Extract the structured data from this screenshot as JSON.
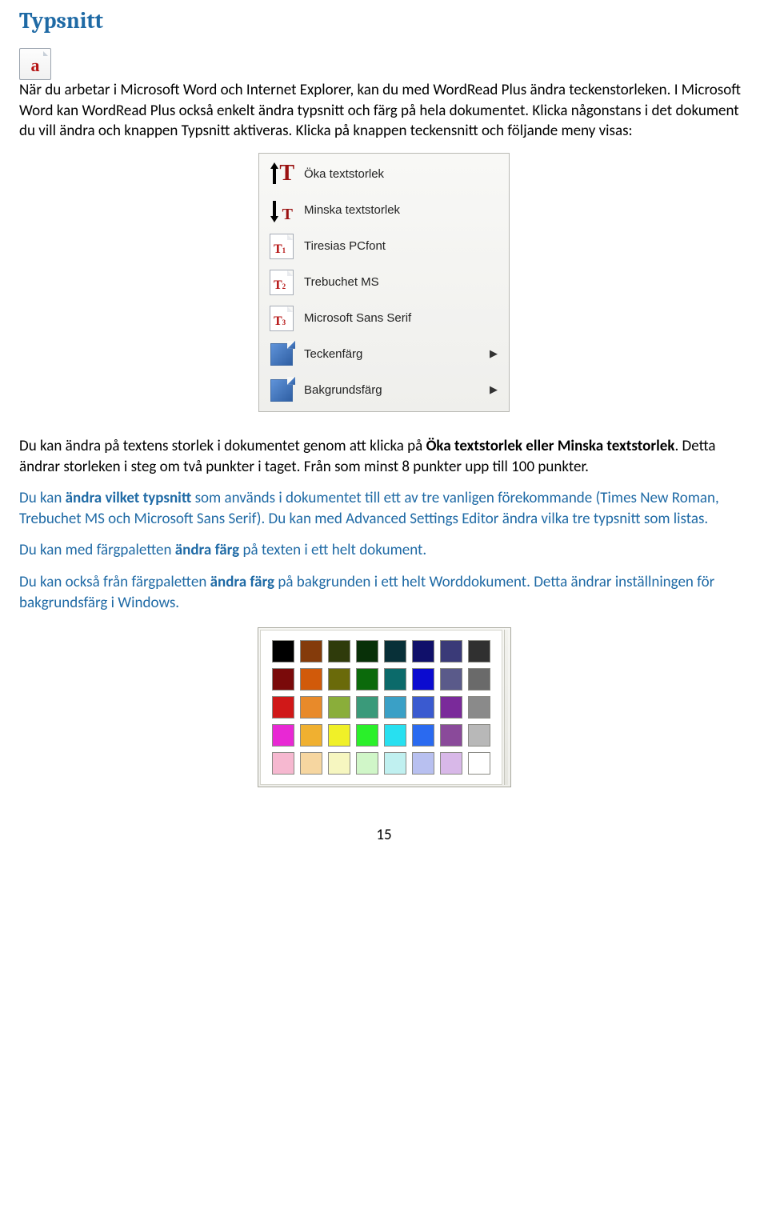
{
  "section_title": "Typsnitt",
  "intro_a": "När du arbetar i Microsoft Word och Internet Explorer, kan du med WordRead Plus ändra teckenstorleken. I Microsoft Word kan WordRead Plus också enkelt ändra typsnitt och färg på hela dokumentet. Klicka någonstans i det dokument du vill ändra och knappen Typsnitt aktiveras. Klicka på knappen teckensnitt och följande meny visas:",
  "menu": {
    "items": [
      {
        "label": "Öka textstorlek"
      },
      {
        "label": "Minska textstorlek"
      },
      {
        "label": "Tiresias PCfont"
      },
      {
        "label": "Trebuchet MS"
      },
      {
        "label": "Microsoft Sans Serif"
      },
      {
        "label": "Teckenfärg"
      },
      {
        "label": "Bakgrundsfärg"
      }
    ]
  },
  "p1_a": "Du kan ändra på textens storlek i dokumentet genom att klicka på ",
  "p1_b": "Öka textstorlek eller Minska textstorlek",
  "p1_c": ". Detta ändrar storleken i steg om två punkter i taget. Från som minst 8 punkter upp till 100 punkter.",
  "p2_a": "Du kan ",
  "p2_b": "ändra vilket typsnitt",
  "p2_c": " som används i dokumentet till ett av tre vanligen förekommande (Times New Roman, Trebuchet MS och Microsoft Sans Serif). Du kan med Advanced Settings Editor ändra vilka tre typsnitt som listas.",
  "p3_a": "Du kan med färgpaletten ",
  "p3_b": "ändra färg",
  "p3_c": " på texten i ett helt dokument.",
  "p4_a": "Du kan också från färgpaletten ",
  "p4_b": "ändra färg",
  "p4_c": " på bakgrunden i ett helt Worddokument. Detta ändrar inställningen för bakgrundsfärg i Windows.",
  "palette_colors": [
    "#000000",
    "#843b0b",
    "#2f3b0b",
    "#083008",
    "#083038",
    "#10106a",
    "#3a3a78",
    "#303030",
    "#7a0a0a",
    "#d15a0a",
    "#6a6a0a",
    "#0b6a0b",
    "#0b6a6a",
    "#0b0bd0",
    "#5a5a8a",
    "#6a6a6a",
    "#d01818",
    "#e88a2a",
    "#8aae3a",
    "#3a9a7a",
    "#3aa0c6",
    "#3a5ad0",
    "#7a2a9a",
    "#8a8a8a",
    "#e828d4",
    "#f0b030",
    "#f0f028",
    "#2af02a",
    "#28e0f0",
    "#2a6af0",
    "#8a4a9a",
    "#b8b8b8",
    "#f6b8d0",
    "#f6d6a0",
    "#f6f6c0",
    "#d0f6c8",
    "#c0f0f0",
    "#b8c0f0",
    "#d8b8e8",
    "#ffffff"
  ],
  "page_number": "15"
}
